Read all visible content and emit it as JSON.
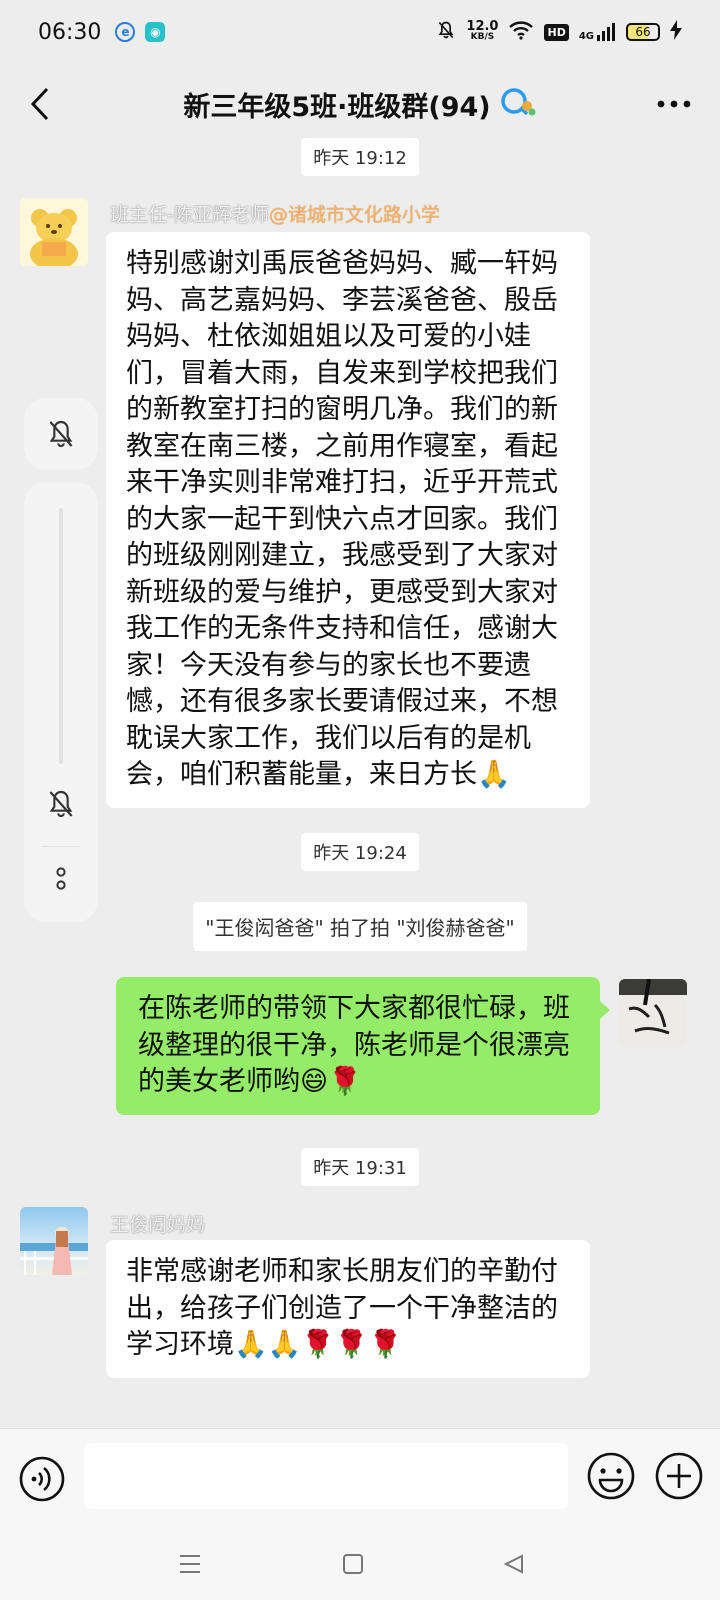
{
  "status_bar": {
    "time": "06:30",
    "net_speed_value": "12.0",
    "net_speed_unit": "KB/S",
    "hd": "HD",
    "network": "4G",
    "battery": "66"
  },
  "header": {
    "title": "新三年级5班·班级群(94)"
  },
  "chat": {
    "timestamp1": "昨天 19:12",
    "msg1": {
      "sender_name": "班主任-陈亚辉老师",
      "sender_org": "@诸城市文化路小学",
      "text": "特别感谢刘禹辰爸爸妈妈、臧一轩妈妈、高艺嘉妈妈、李芸溪爸爸、殷岳妈妈、杜依洳姐姐以及可爱的小娃们，冒着大雨，自发来到学校把我们的新教室打扫的窗明几净。我们的新教室在南三楼，之前用作寝室，看起来干净实则非常难打扫，近乎开荒式的大家一起干到快六点才回家。我们的班级刚刚建立，我感受到了大家对新班级的爱与维护，更感受到大家对我工作的无条件支持和信任，感谢大家！今天没有参与的家长也不要遗憾，还有很多家长要请假过来，不想耽误大家工作，我们以后有的是机会，咱们积蓄能量，来日方长🙏"
    },
    "timestamp2": "昨天 19:24",
    "system_msg": "\"王俊闳爸爸\" 拍了拍 \"刘俊赫爸爸\"",
    "msg2": {
      "text": "在陈老师的带领下大家都很忙碌，班级整理的很干净，陈老师是个很漂亮的美女老师哟😄🌹"
    },
    "timestamp3": "昨天 19:31",
    "msg3": {
      "sender_name": "王俊闳妈妈",
      "text": "非常感谢老师和家长朋友们的辛勤付出，给孩子们创造了一个干净整洁的学习环境🙏🙏🌹🌹🌹"
    }
  },
  "input": {
    "placeholder": ""
  },
  "colors": {
    "background": "#ededed",
    "outgoing_bubble": "#95ec69",
    "incoming_bubble": "#ffffff",
    "sender_org": "#f6b26b"
  }
}
